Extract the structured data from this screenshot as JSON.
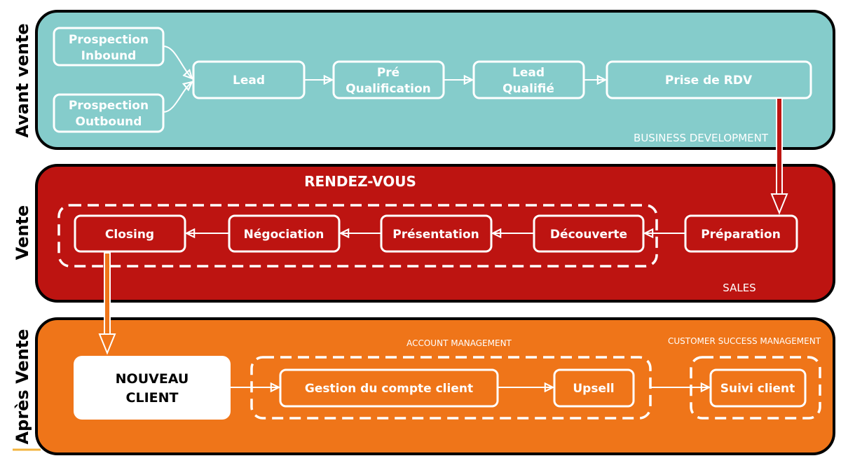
{
  "colors": {
    "avant_vente": "#85CCCB",
    "vente": "#BD1411",
    "apres_vente": "#EF7519",
    "border": "#000000",
    "accent_line": "#F2B33D"
  },
  "lanes": {
    "avant_vente": {
      "label": "Avant vente",
      "team": "BUSINESS DEVELOPMENT",
      "steps": [
        "Prospection Inbound",
        "Prospection Outbound",
        "Lead",
        "Pré Qualification",
        "Lead Qualifié",
        "Prise de RDV"
      ],
      "lines": {
        "inbound": [
          "Prospection",
          "Inbound"
        ],
        "outbound": [
          "Prospection",
          "Outbound"
        ],
        "prequal": [
          "Pré",
          "Qualification"
        ],
        "leadq": [
          "Lead",
          "Qualifié"
        ]
      }
    },
    "vente": {
      "label": "Vente",
      "group": "RENDEZ-VOUS",
      "team": "SALES",
      "steps": [
        "Préparation",
        "Découverte",
        "Présentation",
        "Négociation",
        "Closing"
      ]
    },
    "apres_vente": {
      "label": "Après Vente",
      "new_client": [
        "NOUVEAU",
        "CLIENT"
      ],
      "account_group": "ACCOUNT MANAGEMENT",
      "csm_group": "CUSTOMER SUCCESS MANAGEMENT",
      "steps": [
        "Gestion du compte client",
        "Upsell",
        "Suivi client"
      ]
    }
  }
}
